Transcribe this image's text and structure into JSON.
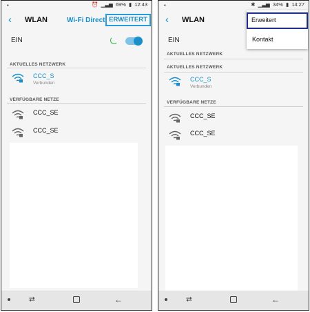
{
  "left": {
    "status": {
      "battery": "69%",
      "time": "12:43"
    },
    "header": {
      "title": "WLAN",
      "wifi_direct": "Wi-Fi Direct",
      "advanced": "ERWEITERT"
    },
    "ein_label": "EIN",
    "current_section": "AKTUELLES NETZWERK",
    "current_network": {
      "name": "CCC_S",
      "status": "Verbunden"
    },
    "available_section": "VERFÜGBARE NETZE",
    "available": [
      {
        "name": "CCC_SE"
      },
      {
        "name": "CCC_SE"
      }
    ]
  },
  "right": {
    "status": {
      "battery": "34%",
      "time": "14:27"
    },
    "header": {
      "title": "WLAN"
    },
    "ein_label": "EIN",
    "menu": [
      {
        "label": "Erweitert"
      },
      {
        "label": "Kontakt"
      }
    ],
    "current_section": "AKTUELLES NETZWERK",
    "current_network": {
      "name": "CCC_S",
      "status": "Verbunden"
    },
    "available_section": "VERFÜGBARE NETZE",
    "available": [
      {
        "name": "CCC_SE"
      },
      {
        "name": "CCC_SE"
      }
    ]
  },
  "colors": {
    "accent": "#1a8fc9",
    "highlight_blue": "#2a9bd8",
    "menu_highlight": "#1e2f8c"
  },
  "icons": [
    "back-icon",
    "wifi-lock-icon",
    "signal-icon",
    "battery-icon",
    "recent-apps-icon",
    "home-icon",
    "nav-back-icon"
  ]
}
